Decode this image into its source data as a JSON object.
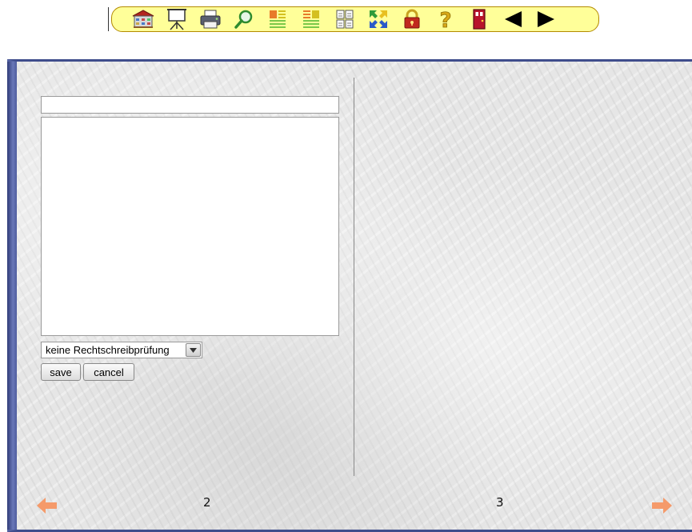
{
  "toolbar": {
    "buttons": [
      {
        "name": "library-icon",
        "tooltip": ""
      },
      {
        "name": "presentation-board-icon",
        "tooltip": ""
      },
      {
        "name": "printer-icon",
        "tooltip": ""
      },
      {
        "name": "magnifier-icon",
        "tooltip": ""
      },
      {
        "name": "page-layout-left-icon",
        "tooltip": ""
      },
      {
        "name": "page-layout-right-icon",
        "tooltip": ""
      },
      {
        "name": "two-pages-icon",
        "tooltip": ""
      },
      {
        "name": "fullscreen-arrows-icon",
        "tooltip": ""
      },
      {
        "name": "lock-icon",
        "tooltip": ""
      },
      {
        "name": "help-question-icon",
        "tooltip": ""
      },
      {
        "name": "exit-door-icon",
        "tooltip": ""
      },
      {
        "name": "previous-triangle-icon",
        "tooltip": ""
      },
      {
        "name": "next-triangle-icon",
        "tooltip": ""
      }
    ],
    "bar_color": "#ffff99",
    "border_color": "#b38a00"
  },
  "editor": {
    "title_value": "",
    "body_value": "",
    "spellcheck_selected": "keine Rechtschreibprüfung",
    "save_label": "save",
    "cancel_label": "cancel"
  },
  "pages": {
    "left_number": "2",
    "right_number": "3"
  },
  "colors": {
    "book_border": "#5563a3",
    "nav_arrow": "#f59a6a"
  }
}
